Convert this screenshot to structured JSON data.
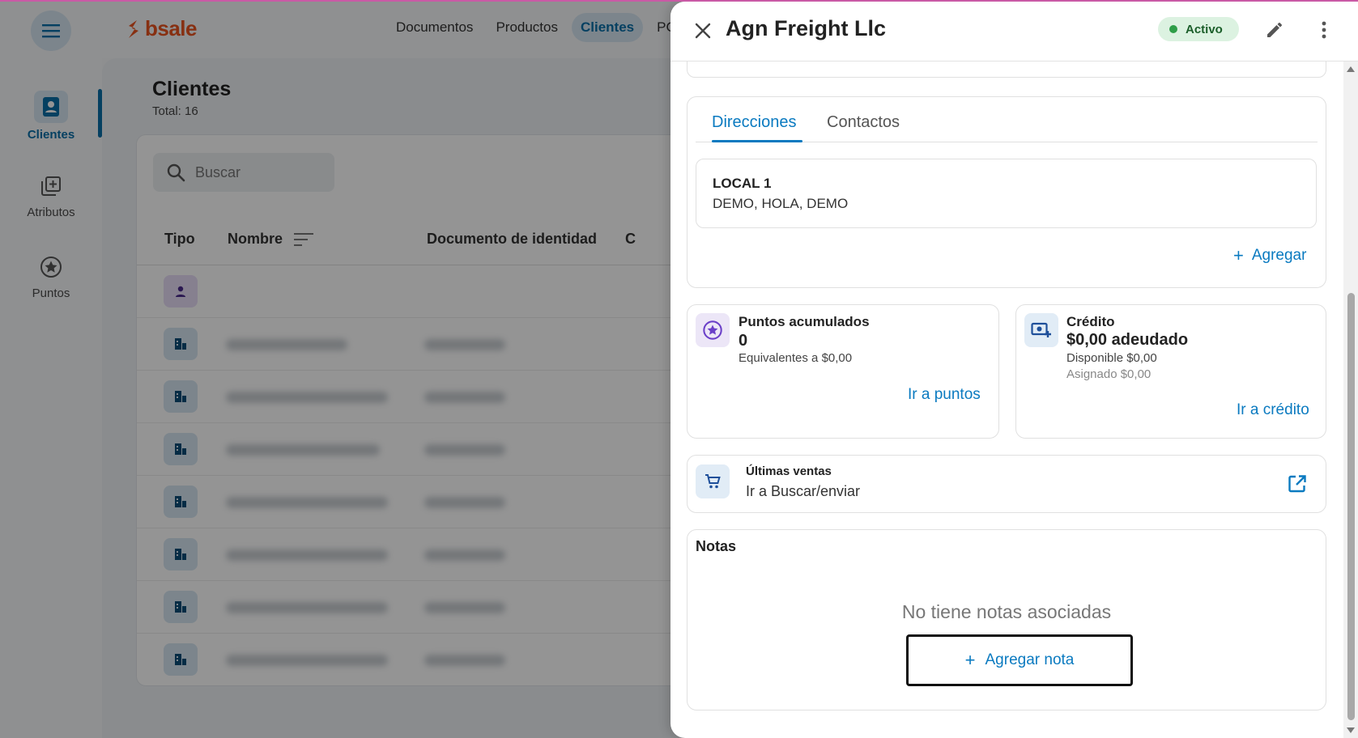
{
  "app": {
    "logo_text": "bsale",
    "rail": [
      {
        "label": "Clientes",
        "icon": "contact-book-icon",
        "active": true
      },
      {
        "label": "Atributos",
        "icon": "library-add-icon",
        "active": false
      },
      {
        "label": "Puntos",
        "icon": "star-circle-icon",
        "active": false
      }
    ],
    "nav": [
      {
        "label": "Documentos"
      },
      {
        "label": "Productos"
      },
      {
        "label": "Clientes",
        "active": true
      },
      {
        "label": "PC"
      }
    ],
    "page_title": "Clientes",
    "page_total": "Total: 16",
    "search_placeholder": "Buscar",
    "columns": [
      "Tipo",
      "Nombre",
      "Documento de identidad",
      "C"
    ]
  },
  "drawer": {
    "title": "Agn Freight Llc",
    "status": "Activo",
    "tabs": [
      "Direcciones",
      "Contactos"
    ],
    "address": {
      "name": "LOCAL 1",
      "line": "DEMO, HOLA, DEMO"
    },
    "add_address": "Agregar",
    "points": {
      "title": "Puntos acumulados",
      "value": "0",
      "equivalent": "Equivalentes a $0,00",
      "link": "Ir a puntos"
    },
    "credit": {
      "title": "Crédito",
      "owed": "$0,00 adeudado",
      "available": "Disponible $0,00",
      "assigned": "Asignado $0,00",
      "link": "Ir a crédito"
    },
    "sales": {
      "title": "Últimas ventas",
      "link": "Ir a Buscar/enviar"
    },
    "notes": {
      "title": "Notas",
      "empty": "No tiene notas asociadas",
      "add": "Agregar nota"
    }
  },
  "colors": {
    "accent": "#0a7ac0",
    "brand": "#e8531f",
    "status_bg": "#dcf2e1",
    "status_dot": "#2e9e48"
  }
}
